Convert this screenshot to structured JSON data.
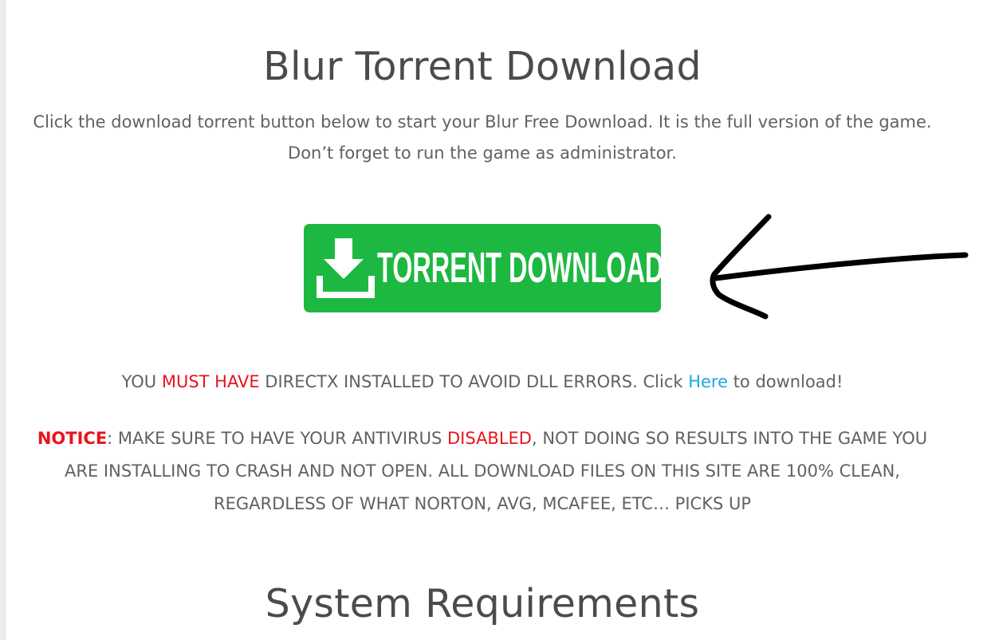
{
  "page": {
    "title": "Blur Torrent Download",
    "intro_line1": "Click the download torrent button below to start your Blur Free Download. It is the full version of the game.",
    "intro_line2": "Don’t forget to run the game as administrator."
  },
  "download_button": {
    "label": "TORRENT DOWNLOAD",
    "icon": "download-icon",
    "color": "#1db841"
  },
  "annotation": {
    "icon": "hand-drawn-arrow-icon",
    "color": "#000000"
  },
  "directx": {
    "prefix": "YOU ",
    "emphasis": "MUST HAVE",
    "middle": " DIRECTX INSTALLED TO AVOID DLL ERRORS. Click ",
    "link_text": "Here",
    "suffix": " to download!"
  },
  "notice": {
    "label": "NOTICE",
    "part1": ": MAKE SURE TO HAVE YOUR ANTIVIRUS ",
    "emphasis": "DISABLED",
    "part2": ", NOT DOING SO RESULTS INTO THE GAME YOU ARE INSTALLING TO CRASH AND NOT OPEN. ALL DOWNLOAD FILES ON THIS SITE ARE 100% CLEAN, REGARDLESS OF WHAT NORTON, AVG, MCAFEE, ETC… PICKS UP"
  },
  "system_requirements": {
    "title": "System Requirements"
  },
  "colors": {
    "accent_red": "#e8141b",
    "link_blue": "#1ea8e0",
    "text_gray": "#616161"
  }
}
